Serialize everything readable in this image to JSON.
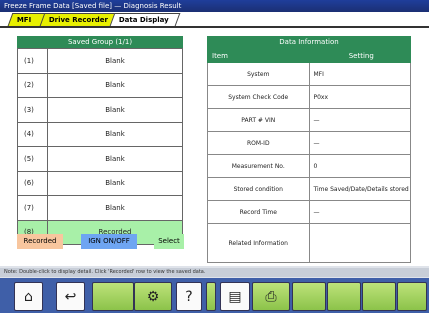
{
  "window": {
    "title": "Freeze Frame Data [Saved file] — Diagnosis Result"
  },
  "tabs": [
    {
      "label": "MFI"
    },
    {
      "label": "Drive Recorder"
    },
    {
      "label": "Data Display"
    }
  ],
  "freeze_frame": {
    "title": "Saved Group (1/1)",
    "rows": [
      {
        "index": "(1)",
        "value": "Blank"
      },
      {
        "index": "(2)",
        "value": "Blank"
      },
      {
        "index": "(3)",
        "value": "Blank"
      },
      {
        "index": "(4)",
        "value": "Blank"
      },
      {
        "index": "(5)",
        "value": "Blank"
      },
      {
        "index": "(6)",
        "value": "Blank"
      },
      {
        "index": "(7)",
        "value": "Blank"
      },
      {
        "index": "(8)",
        "value": "Recorded"
      }
    ]
  },
  "legend": {
    "recorded": "Recorded",
    "ign": "IGN ON/OFF",
    "select": "Select"
  },
  "data_info": {
    "title": "Data Information",
    "col_item": "Item",
    "col_setting": "Setting",
    "rows": [
      {
        "item": "System",
        "value": "MFI"
      },
      {
        "item": "System Check Code",
        "value": "P0xx"
      },
      {
        "item": "PART #  VIN",
        "value": "—"
      },
      {
        "item": "ROM-ID",
        "value": "—"
      },
      {
        "item": "Measurement No.",
        "value": "0"
      },
      {
        "item": "Stored condition",
        "value": "Time Saved/Date/Details stored"
      },
      {
        "item": "Record Time",
        "value": "—"
      },
      {
        "item": "Related Information",
        "value": ""
      }
    ]
  },
  "status_bar": {
    "text": "Note: Double-click to display detail. Click 'Recorded' row to view the saved data."
  },
  "toolbar": {
    "icons": [
      "home-icon",
      "back-icon",
      "settings-icon",
      "help-icon",
      "graph-icon",
      "print-icon"
    ]
  }
}
